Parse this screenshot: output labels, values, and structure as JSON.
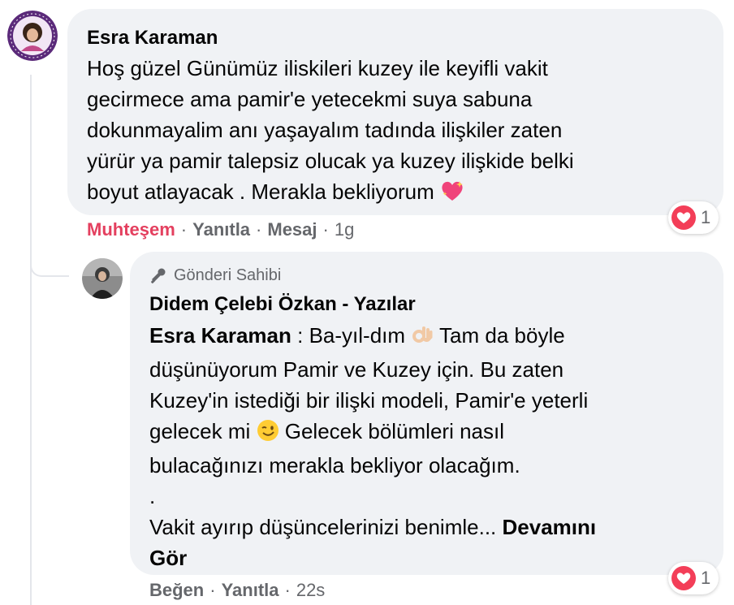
{
  "comment": {
    "author": "Esra Karaman",
    "lines": [
      "Hoş güzel Günümüz iliskileri kuzey ile keyifli vakit",
      "gecirmece ama pamir'e yetecekmi suya sabuna",
      "dokunmayalim anı yaşayalım tadında ilişkiler zaten",
      "yürür ya pamir talepsiz olucak ya kuzey ilişkide belki",
      "boyut atlayacak . Merakla bekliyorum"
    ],
    "end_emoji": "sparkling-heart-icon",
    "actions": {
      "reaction": "Muhteşem",
      "reply": "Yanıtla",
      "message": "Mesaj",
      "time": "1g"
    },
    "reaction_count": "1"
  },
  "reply": {
    "badge": "Gönderi Sahibi",
    "author": "Didem Çelebi Özkan - Yazılar",
    "mention": "Esra Karaman",
    "line1_rest": ": Ba-yıl-dım",
    "line1_after_emoji": "Tam da böyle",
    "line2": "düşünüyorum Pamir ve Kuzey için. Bu zaten",
    "line3": "Kuzey'in istediği bir ilişki modeli, Pamir'e yeterli",
    "line4_before": "gelecek mi",
    "line4_after": "Gelecek bölümleri nasıl",
    "line5": "bulacağınızı merakla bekliyor olacağım.",
    "line6": ".",
    "line7": "Vakit ayırıp düşüncelerinizi benimle...",
    "see_more_1": "Devamını",
    "see_more_2": "Gör",
    "actions": {
      "like": "Beğen",
      "reply": "Yanıtla",
      "time": "22s"
    },
    "reaction_count": "1"
  },
  "colors": {
    "bubble": "#f0f2f5",
    "meta": "#65676b",
    "love": "#e4405f",
    "heart": "#f33e58"
  }
}
